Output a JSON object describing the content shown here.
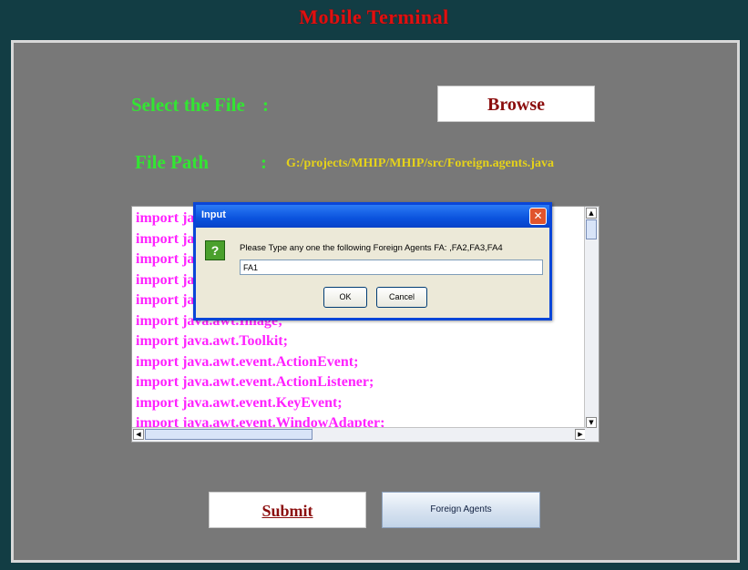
{
  "window": {
    "title": "Mobile Terminal"
  },
  "form": {
    "select_label": "Select the File",
    "select_colon": ":",
    "browse_label": "Browse",
    "path_label": "File Path",
    "path_colon": ":",
    "path_value": "G:/projects/MHIP/MHIP/src/Foreign.agents.java"
  },
  "editor": {
    "lines": [
      "import ja",
      "import ja",
      "import ja",
      "import ja",
      "import ja",
      "import java.awt.Image;",
      "import java.awt.Toolkit;",
      "import java.awt.event.ActionEvent;",
      "import java.awt.event.ActionListener;",
      "import java.awt.event.KeyEvent;",
      "import java.awt.event.WindowAdapter;"
    ]
  },
  "dialog": {
    "title": "Input",
    "close_glyph": "✕",
    "icon_glyph": "?",
    "message": "Please Type any one the following Foreign Agents FA: ,FA2,FA3,FA4",
    "input_value": "FA1",
    "ok_label": "OK",
    "cancel_label": "Cancel"
  },
  "actions": {
    "submit_label": "Submit",
    "foreign_agents_label": "Foreign Agents"
  },
  "colors": {
    "frame": "#123d44",
    "panel": "#787878",
    "title": "#e01010",
    "label_green": "#33e533",
    "path_yellow": "#e5d21a",
    "code_magenta": "#ff22ff"
  }
}
